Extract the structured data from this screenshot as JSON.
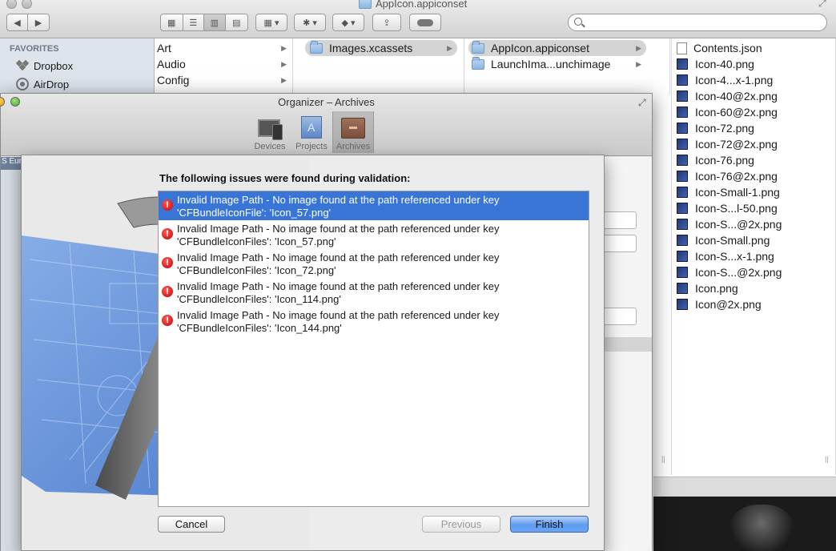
{
  "finder": {
    "title": "AppIcon.appiconset",
    "search": {
      "value": "",
      "placeholder": ""
    },
    "sidebar": {
      "heading": "FAVORITES",
      "items": [
        {
          "label": "Dropbox",
          "icon": "dropbox-icon"
        },
        {
          "label": "AirDrop",
          "icon": "airdrop-icon"
        }
      ]
    },
    "columns": {
      "col1": [
        "Art",
        "Audio",
        "Config"
      ],
      "col2": [
        "Images.xcassets"
      ],
      "col3": [
        "AppIcon.appiconset",
        "LaunchIma...unchimage"
      ],
      "col4_header": "Contents.json",
      "col4": [
        "Icon-40.png",
        "Icon-4...x-1.png",
        "Icon-40@2x.png",
        "Icon-60@2x.png",
        "Icon-72.png",
        "Icon-72@2x.png",
        "Icon-76.png",
        "Icon-76@2x.png",
        "Icon-Small-1.png",
        "Icon-S...l-50.png",
        "Icon-S...@2x.png",
        "Icon-Small.png",
        "Icon-S...x-1.png",
        "Icon-S...@2x.png",
        "Icon.png",
        "Icon@2x.png"
      ]
    }
  },
  "organizer": {
    "title": "Organizer – Archives",
    "tabs": [
      {
        "label": "Devices",
        "icon": "devices-icon"
      },
      {
        "label": "Projects",
        "icon": "projects-icon"
      },
      {
        "label": "Archives",
        "icon": "archives-icon"
      }
    ],
    "left_label": "S Euro",
    "colors": {
      "selection": "#3875d7",
      "error": "#d40000"
    }
  },
  "sheet": {
    "heading": "The following issues were found during validation:",
    "issues": [
      {
        "line1": "Invalid Image Path - No image found at the path referenced under key",
        "line2": "'CFBundleIconFile': 'Icon_57.png'"
      },
      {
        "line1": "Invalid Image Path - No image found at the path referenced under key",
        "line2": "'CFBundleIconFiles': 'Icon_57.png'"
      },
      {
        "line1": "Invalid Image Path - No image found at the path referenced under key",
        "line2": "'CFBundleIconFiles': 'Icon_72.png'"
      },
      {
        "line1": "Invalid Image Path - No image found at the path referenced under key",
        "line2": "'CFBundleIconFiles': 'Icon_114.png'"
      },
      {
        "line1": "Invalid Image Path - No image found at the path referenced under key",
        "line2": "'CFBundleIconFiles': 'Icon_144.png'"
      }
    ],
    "buttons": {
      "cancel": "Cancel",
      "previous": "Previous",
      "finish": "Finish"
    }
  }
}
